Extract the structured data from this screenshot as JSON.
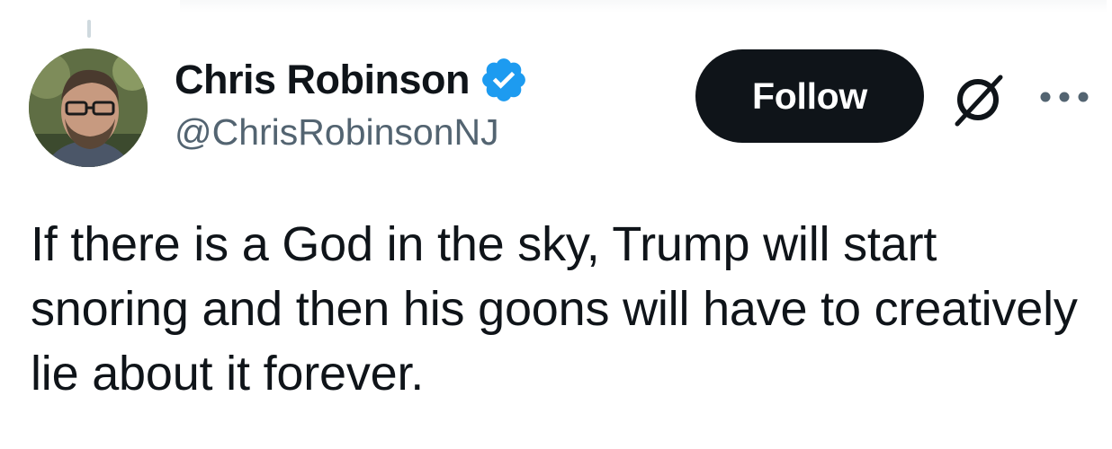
{
  "tweet": {
    "author": {
      "display_name": "Chris Robinson",
      "handle": "@ChrisRobinsonNJ",
      "verified": true,
      "verified_color": "#1d9bf0"
    },
    "follow_label": "Follow",
    "text": "If there is a God in the sky, Trump will start snoring and then his goons will have to creatively lie about it forever."
  },
  "icons": {
    "verified": "verified-badge-icon",
    "grok": "grok-icon",
    "more": "more-horizontal-icon"
  },
  "colors": {
    "text_primary": "#0f1419",
    "text_secondary": "#536471",
    "button_bg": "#0f1419",
    "button_text": "#ffffff"
  }
}
